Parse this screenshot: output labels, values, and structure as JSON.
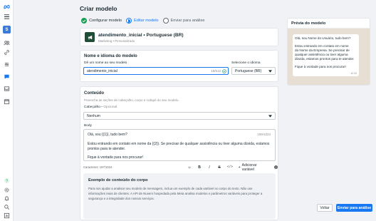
{
  "sidebar": {
    "avatar_letter": "S",
    "icons": [
      "meta-logo-icon",
      "menu-icon",
      "profile-icon",
      "people-icon",
      "link-icon",
      "tools-icon",
      "announcement-icon",
      "chat-icon",
      "inbox-icon",
      "calendar-icon",
      "help-icon",
      "settings-icon",
      "bell-icon",
      "search-icon",
      "report-icon"
    ]
  },
  "page": {
    "title": "Criar modelo"
  },
  "steps": [
    {
      "label": "Configurar modelo",
      "state": "done"
    },
    {
      "label": "Editar modelo",
      "state": "active"
    },
    {
      "label": "Enviar para análise",
      "state": "pending"
    }
  ],
  "template": {
    "name": "atendimento_inicial • Portuguese (BR)",
    "meta": "Marketing  •  Personalizado"
  },
  "name_section": {
    "title": "Nome e idioma do modelo",
    "name_label": "Dê um nome ao seu modelo",
    "name_value": "atendimento_inicial",
    "name_count": "19/512",
    "language_label": "Selecione o idioma",
    "language_value": "Portuguese (BR)"
  },
  "content_section": {
    "title": "Conteúdo",
    "subtitle": "Preencha as seções de cabeçalho, corpo e rodapé do seu modelo.",
    "header_label": "Cabeçalho",
    "header_optional": "• Opcional",
    "header_value": "Nenhum",
    "body_label": "Body",
    "body_line1": "Olá, sou {{1}}, tudo bem?",
    "body_line2": "Estou entrando em contato em nome da {{2}}. Se precisar de qualquer assistência ou tiver alguma dúvida, estamos",
    "body_line3": "prontos para te atender.",
    "body_line4": "Fique à vontade para nos procurar!",
    "body_count": "199/1024",
    "chars_label": "Caracteres: 197/1024",
    "toolbar": {
      "emoji": "☺",
      "bold": "B",
      "italic": "I",
      "strike": "S",
      "code": "</>",
      "add_variable": "Adicionar variável"
    }
  },
  "sample_section": {
    "title": "Exemplo de conteúdo do corpo",
    "line1": "Para nos ajudar a analisar seu modelo de mensagem, inclua um exemplo de cada variável no corpo do texto. Não use",
    "line2": "informações reais de clientes. A API de Nuvem hospedada pela Meta analisa modelos e parâmetros variáveis para proteger a",
    "line3": "segurança e a integridade dos nossos serviços."
  },
  "preview": {
    "title": "Prévia do modelo",
    "line1": "Olá, sou Nome do Usuário, tudo bem?",
    "line2": "Estou entrando em contato em nome",
    "line3": "da Nome da Empresa. Se precisar de",
    "line4": "qualquer assistência ou tiver alguma",
    "line5": "dúvida, estamos prontos para te atender.",
    "line6": "Fique à vontade para nos procurar!",
    "time": "12:33"
  },
  "footer": {
    "back_label": "Voltar",
    "submit_label": "Enviar para análise"
  },
  "colors": {
    "accent": "#1877f2",
    "done": "#1a9e54",
    "chat_bg": "#e7ded4"
  }
}
